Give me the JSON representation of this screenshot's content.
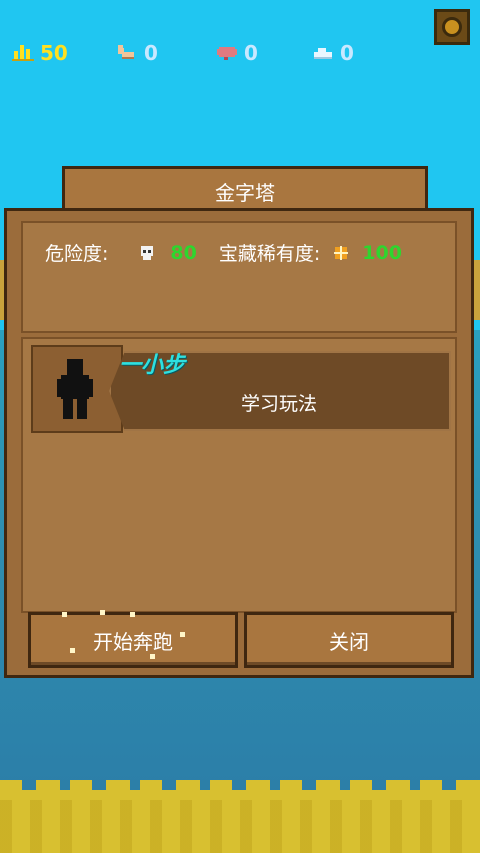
{
  "hud": {
    "pyramid": {
      "value": "50",
      "color": "#ffe020"
    },
    "strength": {
      "value": "0",
      "color": "#c9e8ff"
    },
    "brain": {
      "value": "0",
      "color": "#c9e8ff"
    },
    "cloud": {
      "value": "0",
      "color": "#c9e8ff"
    }
  },
  "dialog": {
    "title": "金字塔",
    "danger_label": "危险度:",
    "danger_value": "80",
    "treasure_label": "宝藏稀有度:",
    "treasure_value": "100",
    "mission_name": "一小步",
    "mission_task": "学习玩法",
    "start_button": "开始奔跑",
    "close_button": "关闭"
  },
  "icons": {
    "settings": "gear-icon",
    "danger": "skull-icon",
    "treasure": "compass-icon",
    "avatar": "silhouette-icon"
  },
  "colors": {
    "accent_green": "#2ed62e",
    "mission_name": "#2ee0e0",
    "wood": "#9b6c3b"
  }
}
